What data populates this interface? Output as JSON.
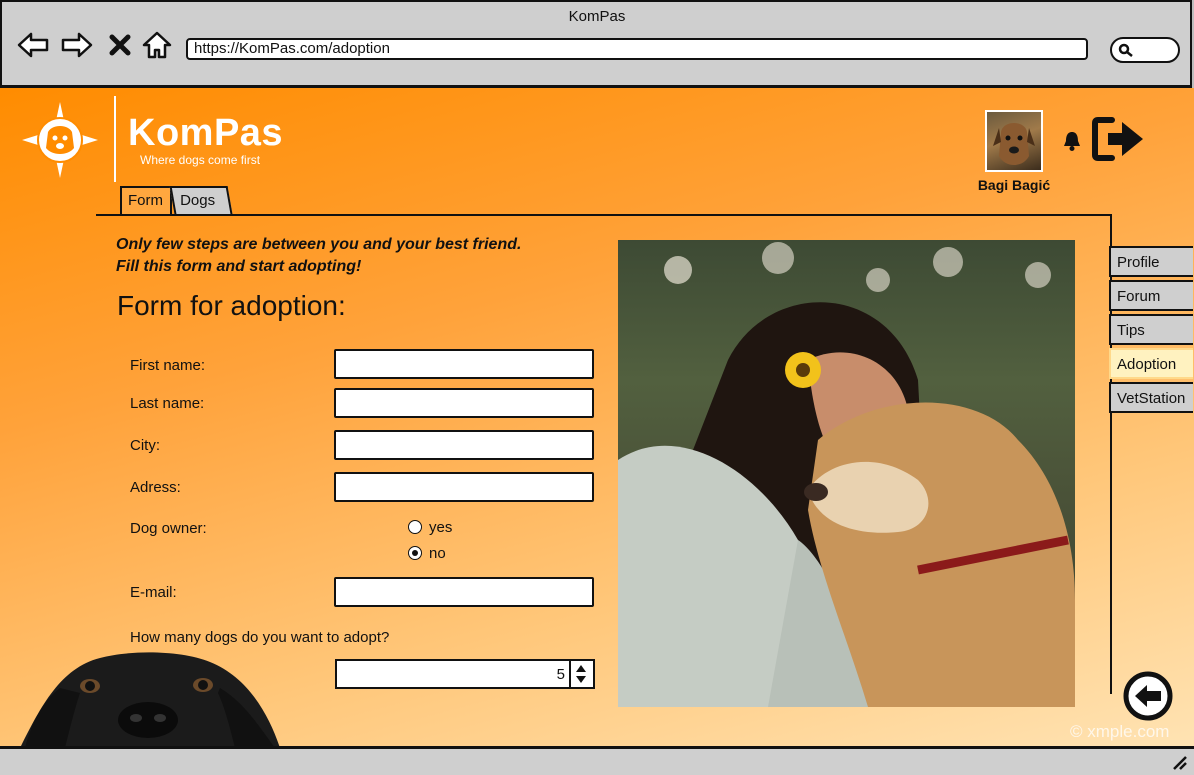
{
  "browser": {
    "window_title": "KomPas",
    "url": "https://KomPas.com/adoption",
    "icons": [
      "back-arrow-icon",
      "forward-arrow-icon",
      "close-icon",
      "home-icon",
      "search-icon"
    ]
  },
  "header": {
    "brand": "KomPas",
    "tagline": "Where dogs come first",
    "username": "Bagi Bagić",
    "icons": [
      "compass-dog-logo-icon",
      "bell-icon",
      "logout-icon"
    ]
  },
  "tabs": [
    {
      "label": "Form",
      "active": true
    },
    {
      "label": "Dogs",
      "active": false
    }
  ],
  "intro": {
    "line1": "Only few steps are between you and your best friend.",
    "line2": "Fill this form and start adopting!"
  },
  "form": {
    "title": "Form for adoption:",
    "first_name_label": "First name:",
    "first_name_value": "",
    "last_name_label": "Last name:",
    "last_name_value": "",
    "city_label": "City:",
    "city_value": "",
    "address_label": "Adress:",
    "address_value": "",
    "dog_owner_label": "Dog owner:",
    "dog_owner_options": [
      "yes",
      "no"
    ],
    "dog_owner_selected": "no",
    "email_label": "E-mail:",
    "email_value": "",
    "dogs_count_label": "How many dogs do you want to adopt?",
    "dogs_count_value": "5"
  },
  "side_menu": [
    {
      "label": "Profile",
      "active": false
    },
    {
      "label": "Forum",
      "active": false
    },
    {
      "label": "Tips",
      "active": false
    },
    {
      "label": "Adoption",
      "active": true
    },
    {
      "label": "VetStation",
      "active": false
    }
  ],
  "watermark": "© xmple.com",
  "colors": {
    "accent": "#ff8c00",
    "page_bottom": "#ffe3b3",
    "chrome": "#cfcfcf"
  }
}
